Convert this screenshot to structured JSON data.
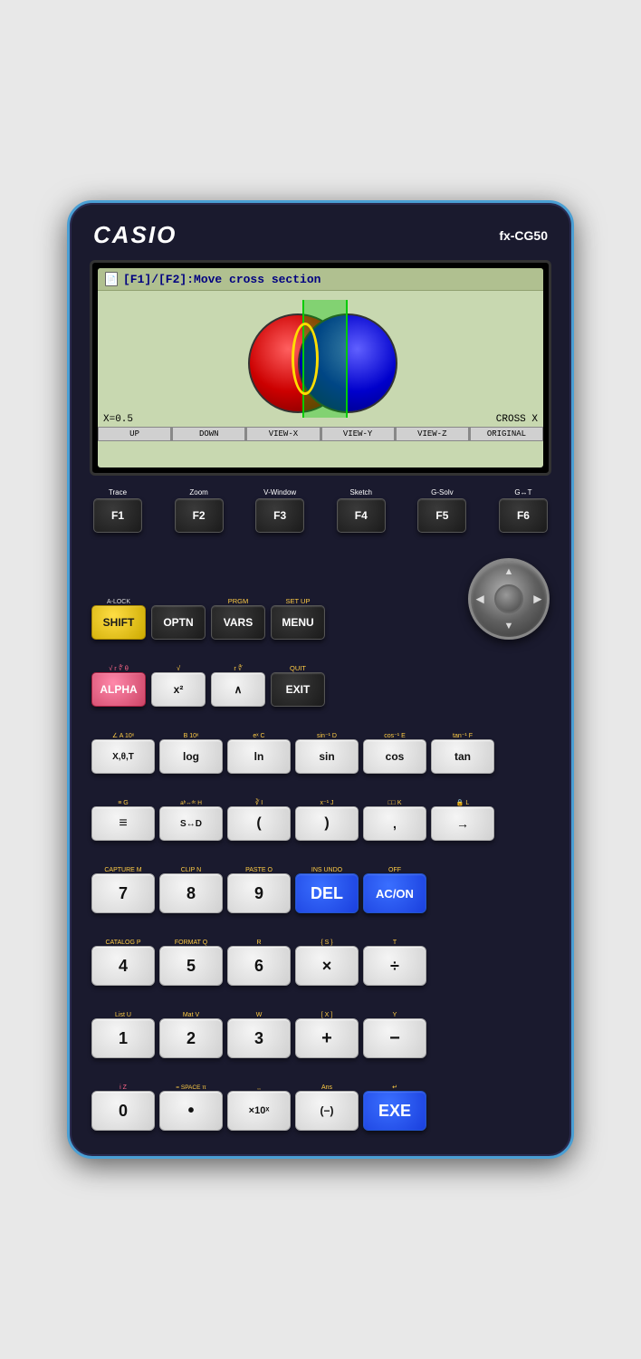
{
  "brand": "CASIO",
  "model": "fx-CG50",
  "screen": {
    "title": "[F1]/[F2]:Move cross section",
    "x_label": "X=0.5",
    "cross_label": "CROSS X",
    "menu_buttons": [
      "UP",
      "DOWN",
      "VIEW-X",
      "VIEW-Y",
      "VIEW-Z",
      "ORIGINAL"
    ]
  },
  "fkeys": [
    {
      "label": "Trace",
      "key": "F1"
    },
    {
      "label": "Zoom",
      "key": "F2"
    },
    {
      "label": "V-Window",
      "key": "F3"
    },
    {
      "label": "Sketch",
      "key": "F4"
    },
    {
      "label": "G-Solv",
      "key": "F5"
    },
    {
      "label": "G↔T",
      "key": "F6"
    }
  ],
  "row1": {
    "above_vars": "PRGM",
    "above_menu": "SET UP",
    "keys": [
      "SHIFT",
      "OPTN",
      "VARS",
      "MENU"
    ]
  },
  "row2": {
    "above_alpha": "A-LOCK",
    "above_exit": "QUIT",
    "keys": [
      "ALPHA",
      "x²",
      "∧",
      "EXIT"
    ]
  },
  "row3": {
    "keys": [
      "X,θ,T",
      "log",
      "ln",
      "sin",
      "cos",
      "tan"
    ],
    "above": [
      "∠ A",
      "10ˣ B",
      "eˣ C",
      "sin⁻¹ D",
      "cos⁻¹ E",
      "tan⁻¹ F"
    ]
  },
  "row4": {
    "keys": [
      "≡",
      "S↔D",
      "(",
      ")",
      ",",
      "→"
    ],
    "above": [
      "≡G",
      "aᵇ⁄ᶜ↔ᵈᶜ H",
      "∛ I",
      "x⁻¹ J",
      "□□ K",
      "🔒 L"
    ]
  },
  "numrow1": {
    "keys": [
      "7",
      "8",
      "9",
      "DEL",
      "AC/ON"
    ],
    "above": [
      "CAPTURE M",
      "CLIP N",
      "PASTE O",
      "INS UNDO",
      "OFF"
    ]
  },
  "numrow2": {
    "keys": [
      "4",
      "5",
      "6",
      "×",
      "÷"
    ],
    "above": [
      "CATALOG P",
      "FORMAT Q",
      "R",
      "{  S  }",
      "T"
    ]
  },
  "numrow3": {
    "keys": [
      "1",
      "2",
      "3",
      "+",
      "−"
    ],
    "above": [
      "List U",
      "Mat V",
      "W",
      "[ X ]",
      "Y"
    ]
  },
  "numrow4": {
    "keys": [
      "0",
      "•",
      "×10ˣ",
      "(−)",
      "EXE"
    ],
    "above": [
      "i Z",
      "=  SPACE  π",
      ",,",
      "Ans",
      "↵"
    ]
  }
}
